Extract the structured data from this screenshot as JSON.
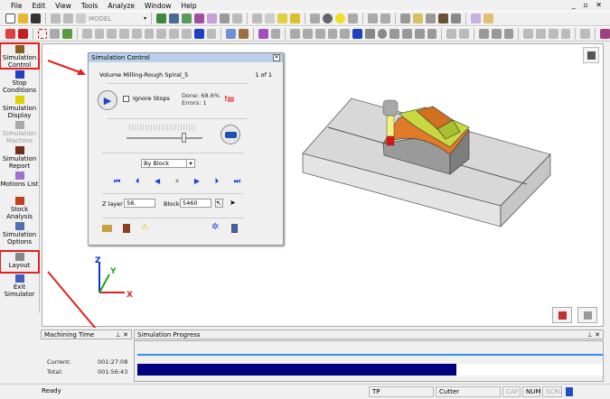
{
  "menu": [
    "File",
    "Edit",
    "View",
    "Tools",
    "Analyze",
    "Window",
    "Help"
  ],
  "toolbar": {
    "model_combo": "MODEL"
  },
  "sidebar": [
    {
      "label": "Simulation Control",
      "icon": "simulation-control-icon",
      "highlighted": true
    },
    {
      "label": "Stop Conditions",
      "icon": "stop-conditions-icon"
    },
    {
      "label": "Simulation Display",
      "icon": "simulation-display-icon"
    },
    {
      "label": "Simulation Machine",
      "icon": "simulation-machine-icon",
      "disabled": true
    },
    {
      "label": "Simulation Report",
      "icon": "simulation-report-icon"
    },
    {
      "label": "Motions List",
      "icon": "motions-list-icon"
    },
    {
      "label": "Stock Analysis",
      "icon": "stock-analysis-icon"
    },
    {
      "label": "Simulation Options",
      "icon": "simulation-options-icon"
    },
    {
      "label": "Layout",
      "icon": "layout-icon",
      "highlighted": true
    },
    {
      "label": "Exit Simulator",
      "icon": "exit-simulator-icon"
    }
  ],
  "sim_control": {
    "title": "Simulation Control",
    "operation": "Volume Milling-Rough Spiral_5",
    "count": "1 of 1",
    "ignore_stops": "Ignore Stops",
    "done_label": "Done:",
    "done_value": "68.6%",
    "errors_label": "Errors:",
    "errors_value": "1",
    "step_mode": "By Block",
    "zlayer_label": "Z layer",
    "zlayer_value": "58.",
    "block_label": "Block",
    "block_value": "5460",
    "speed_fraction": 0.75
  },
  "machining_time": {
    "title": "Machining Time",
    "current_label": "Current:",
    "current": "001:27:08",
    "total_label": "Total:",
    "total": "001:56:43"
  },
  "progress": {
    "title": "Simulation Progress",
    "percent": 68.6,
    "bar_color": "#000080"
  },
  "status": {
    "text": "Ready",
    "tp": "TP",
    "cutter": "Cutter",
    "cap": "CAP",
    "num": "NUM",
    "scrl": "SCRL"
  },
  "triad": {
    "x": "X",
    "y": "Y",
    "z": "Z"
  }
}
